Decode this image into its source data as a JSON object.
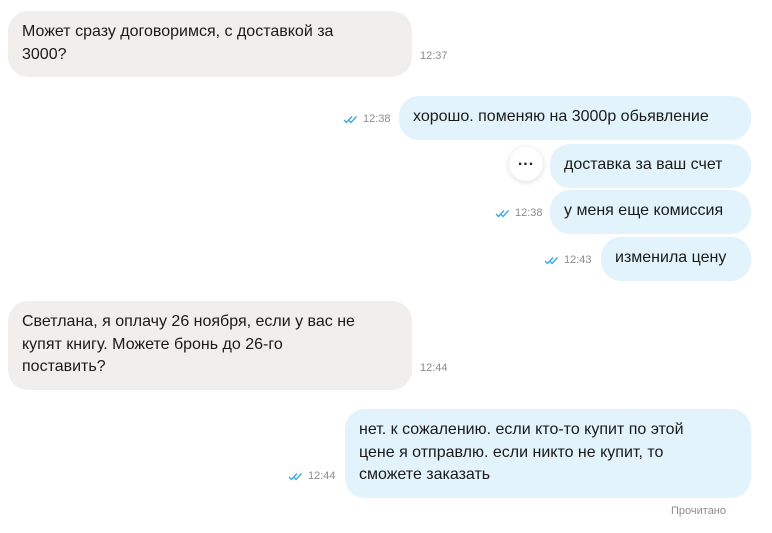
{
  "colors": {
    "incoming_bubble": "#f0efee",
    "outgoing_bubble": "#e2f3fc",
    "read_check": "#3fa9d9",
    "timestamp": "#8c8c8c"
  },
  "messages": [
    {
      "direction": "incoming",
      "lines": [
        "Может сразу договоримся, с доставкой за",
        "3000?"
      ],
      "time": "12:37"
    },
    {
      "direction": "outgoing",
      "lines": [
        "хорошо. поменяю на 3000р обьявление"
      ],
      "time": "12:38",
      "status_icon": "double-check-icon"
    },
    {
      "direction": "outgoing",
      "lines": [
        "доставка за ваш счет"
      ],
      "more_icon": "more-horizontal-icon"
    },
    {
      "direction": "outgoing",
      "lines": [
        "у меня еще комиссия"
      ],
      "time": "12:38",
      "status_icon": "double-check-icon"
    },
    {
      "direction": "outgoing",
      "lines": [
        "изменила цену"
      ],
      "time": "12:43",
      "status_icon": "double-check-icon"
    },
    {
      "direction": "incoming",
      "lines": [
        "Светлана, я оплачу 26 ноября, если у вас не",
        "купят книгу. Можете бронь до 26-го",
        "поставить?"
      ],
      "time": "12:44"
    },
    {
      "direction": "outgoing",
      "lines": [
        "нет. к сожалению. если кто-то купит по этой",
        "цене я отправлю. если никто не купит, то",
        "сможете заказать"
      ],
      "time": "12:44",
      "status_icon": "double-check-icon"
    }
  ],
  "read_status": "Прочитано"
}
